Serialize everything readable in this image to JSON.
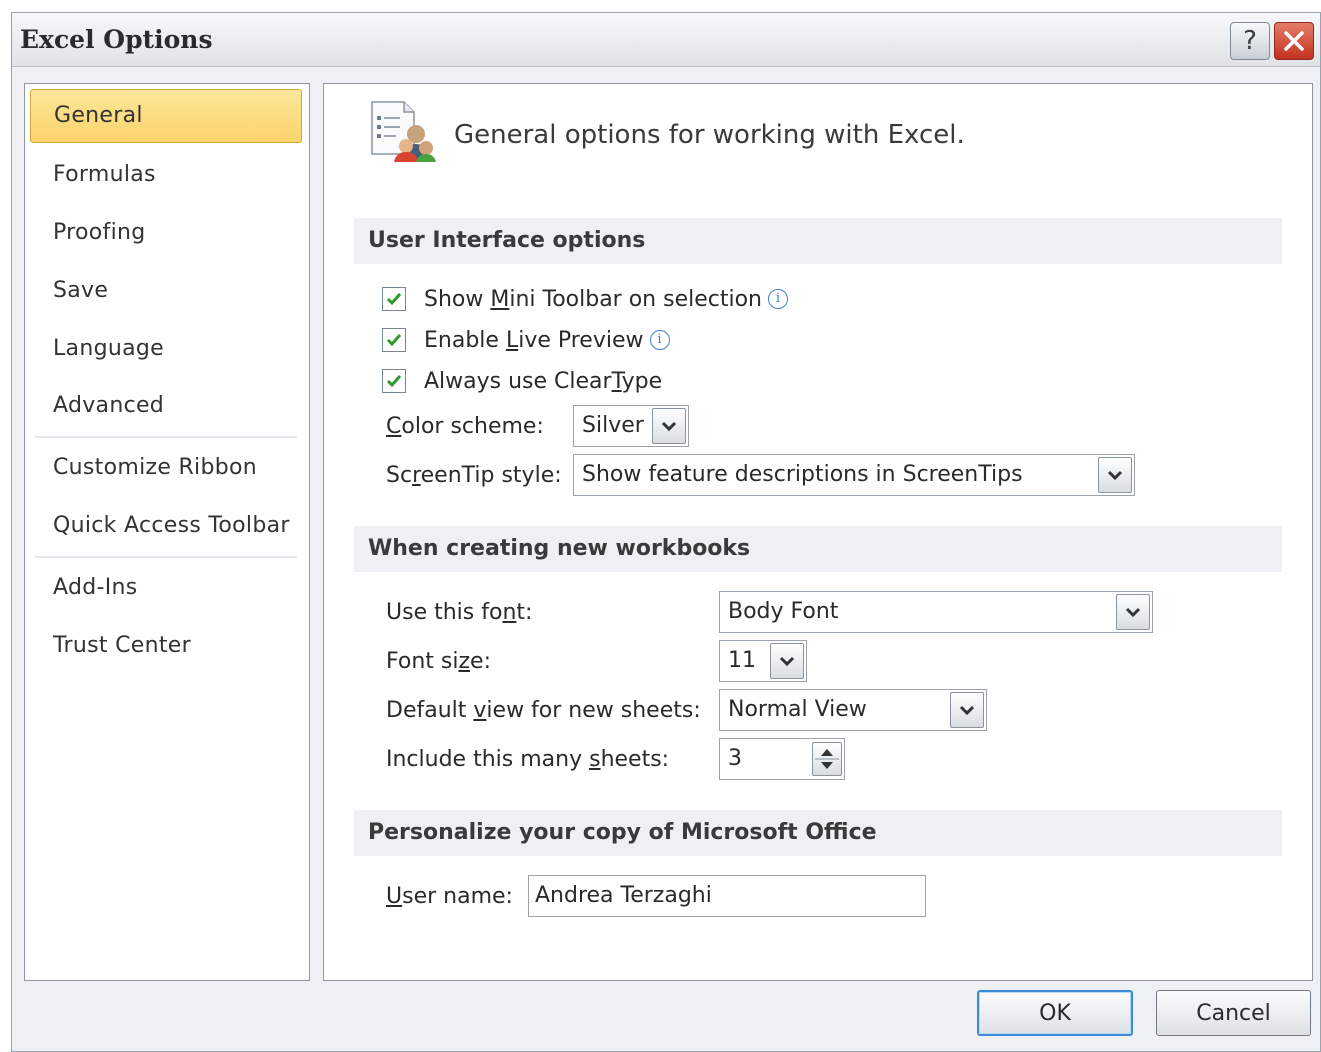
{
  "window": {
    "title": "Excel Options",
    "help_label": "?",
    "close_label": "✕"
  },
  "nav": {
    "items": [
      {
        "label": "General",
        "selected": true
      },
      {
        "label": "Formulas"
      },
      {
        "label": "Proofing"
      },
      {
        "label": "Save"
      },
      {
        "label": "Language"
      },
      {
        "label": "Advanced"
      },
      {
        "label": "Customize Ribbon"
      },
      {
        "label": "Quick Access Toolbar"
      },
      {
        "label": "Add-Ins"
      },
      {
        "label": "Trust Center"
      }
    ]
  },
  "main": {
    "header": "General options for working with Excel.",
    "ui_section": {
      "title": "User Interface options",
      "mini_toolbar": {
        "pre": "Show ",
        "key": "M",
        "post": "ini Toolbar on selection",
        "checked": true
      },
      "live_preview": {
        "pre": "Enable ",
        "key": "L",
        "post": "ive Preview",
        "checked": true
      },
      "cleartype": {
        "pre": "Always use Clear",
        "key": "T",
        "post": "ype",
        "checked": true
      },
      "color_scheme": {
        "key": "C",
        "post": "olor scheme:",
        "value": "Silver"
      },
      "screentip": {
        "pre": "Sc",
        "key": "r",
        "post": "eenTip style:",
        "value": "Show feature descriptions in ScreenTips"
      }
    },
    "workbook_section": {
      "title": "When creating new workbooks",
      "font": {
        "pre": "Use this fo",
        "key": "n",
        "post": "t:",
        "value": "Body Font"
      },
      "font_size": {
        "pre": "Font si",
        "key": "z",
        "post": "e:",
        "value": "11"
      },
      "default_view": {
        "pre": "Default ",
        "key": "v",
        "post": "iew for new sheets:",
        "value": "Normal View"
      },
      "sheets": {
        "pre": "Include this many ",
        "key": "s",
        "post": "heets:",
        "value": "3"
      }
    },
    "personalize_section": {
      "title": "Personalize your copy of Microsoft Office",
      "username": {
        "key": "U",
        "post": "ser name:",
        "value": "Andrea Terzaghi"
      }
    }
  },
  "buttons": {
    "ok": "OK",
    "cancel": "Cancel"
  },
  "colors": {
    "accent": "#fbd36a",
    "check": "#2e9a2e",
    "focus": "#3b8cd6"
  }
}
